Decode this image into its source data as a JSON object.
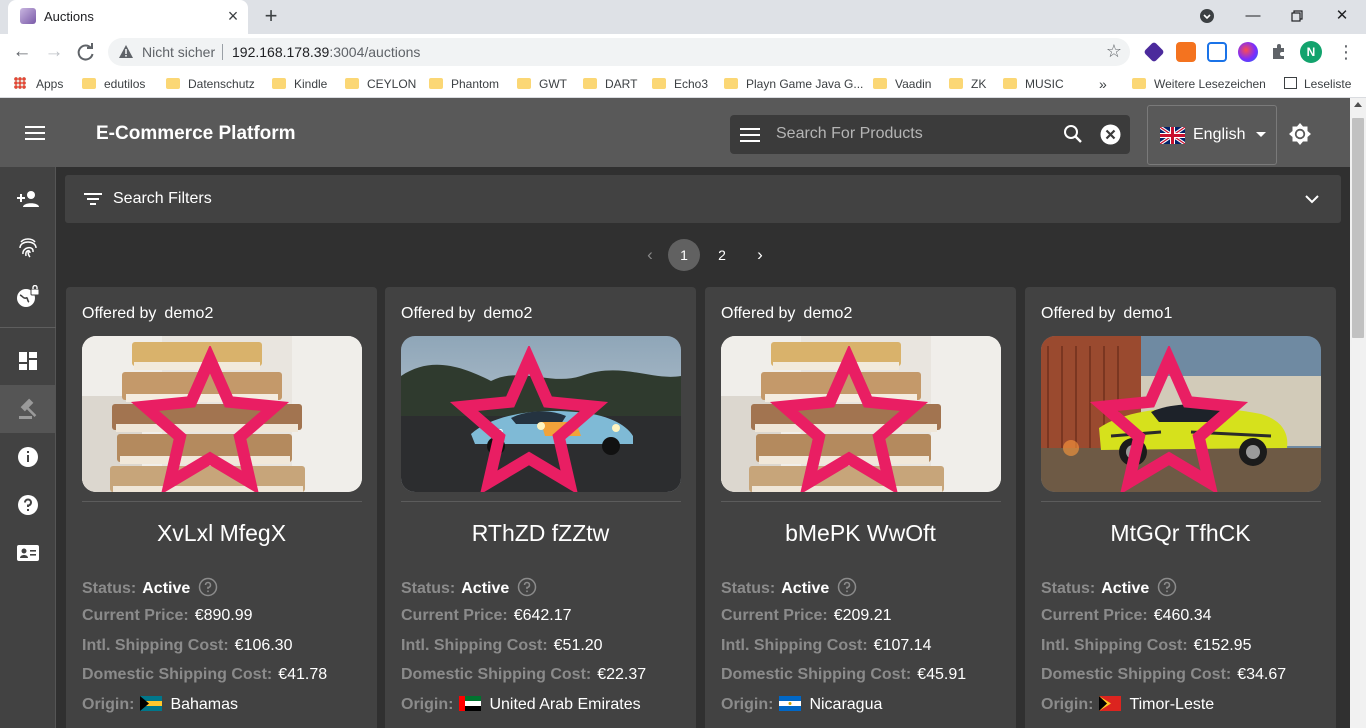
{
  "browser": {
    "tab_title": "Auctions",
    "omnibox": {
      "insecure_label": "Nicht sicher",
      "host": "192.168.178.39",
      "path": ":3004/auctions"
    },
    "profile_initial": "N",
    "bookmarks": [
      {
        "label": "Apps",
        "icon": "apps-grid-icon"
      },
      {
        "label": "edutilos",
        "icon": "folder-icon"
      },
      {
        "label": "Datenschutz",
        "icon": "folder-icon"
      },
      {
        "label": "Kindle",
        "icon": "folder-icon"
      },
      {
        "label": "CEYLON",
        "icon": "folder-icon"
      },
      {
        "label": "Phantom",
        "icon": "folder-icon"
      },
      {
        "label": "GWT",
        "icon": "folder-icon"
      },
      {
        "label": "DART",
        "icon": "folder-icon"
      },
      {
        "label": "Echo3",
        "icon": "folder-icon"
      },
      {
        "label": "Playn Game Java G...",
        "icon": "folder-icon"
      },
      {
        "label": "Vaadin",
        "icon": "folder-icon"
      },
      {
        "label": "ZK",
        "icon": "folder-icon"
      },
      {
        "label": "MUSIC",
        "icon": "folder-icon"
      }
    ],
    "bookmarks_overflow": "»",
    "other_bookmarks": "Weitere Lesezeichen",
    "reading_list": "Leseliste"
  },
  "app": {
    "title": "E-Commerce Platform",
    "search_placeholder": "Search For Products",
    "language": "English",
    "filters_label": "Search Filters",
    "pagination": {
      "pages": [
        "1",
        "2"
      ],
      "current": "1"
    },
    "sidebar_icons": [
      "add-user-icon",
      "fingerprint-icon",
      "globe-lock-icon",
      "dashboard-icon",
      "gavel-icon",
      "info-icon",
      "help-icon",
      "contact-card-icon"
    ],
    "colors": {
      "app_bar": "#595959",
      "background": "#303030",
      "card": "#424242",
      "favorite_star": "#e91e63"
    }
  },
  "labels": {
    "offered_by": "Offered by",
    "status": "Status:",
    "current_price": "Current Price:",
    "intl_shipping": "Intl. Shipping Cost:",
    "domestic_shipping": "Domestic Shipping Cost:",
    "origin": "Origin:"
  },
  "auctions": [
    {
      "seller": "demo2",
      "image": "books",
      "title": "XvLxl MfegX",
      "status": "Active",
      "price": "€890.99",
      "intl_shipping": "€106.30",
      "domestic_shipping": "€41.78",
      "origin": "Bahamas"
    },
    {
      "seller": "demo2",
      "image": "race-car",
      "title": "RThZD fZZtw",
      "status": "Active",
      "price": "€642.17",
      "intl_shipping": "€51.20",
      "domestic_shipping": "€22.37",
      "origin": "United Arab Emirates"
    },
    {
      "seller": "demo2",
      "image": "books",
      "title": "bMePK WwOft",
      "status": "Active",
      "price": "€209.21",
      "intl_shipping": "€107.14",
      "domestic_shipping": "€45.91",
      "origin": "Nicaragua"
    },
    {
      "seller": "demo1",
      "image": "forza-game",
      "title": "MtGQr TfhCK",
      "status": "Active",
      "price": "€460.34",
      "intl_shipping": "€152.95",
      "domestic_shipping": "€34.67",
      "origin": "Timor-Leste"
    }
  ]
}
